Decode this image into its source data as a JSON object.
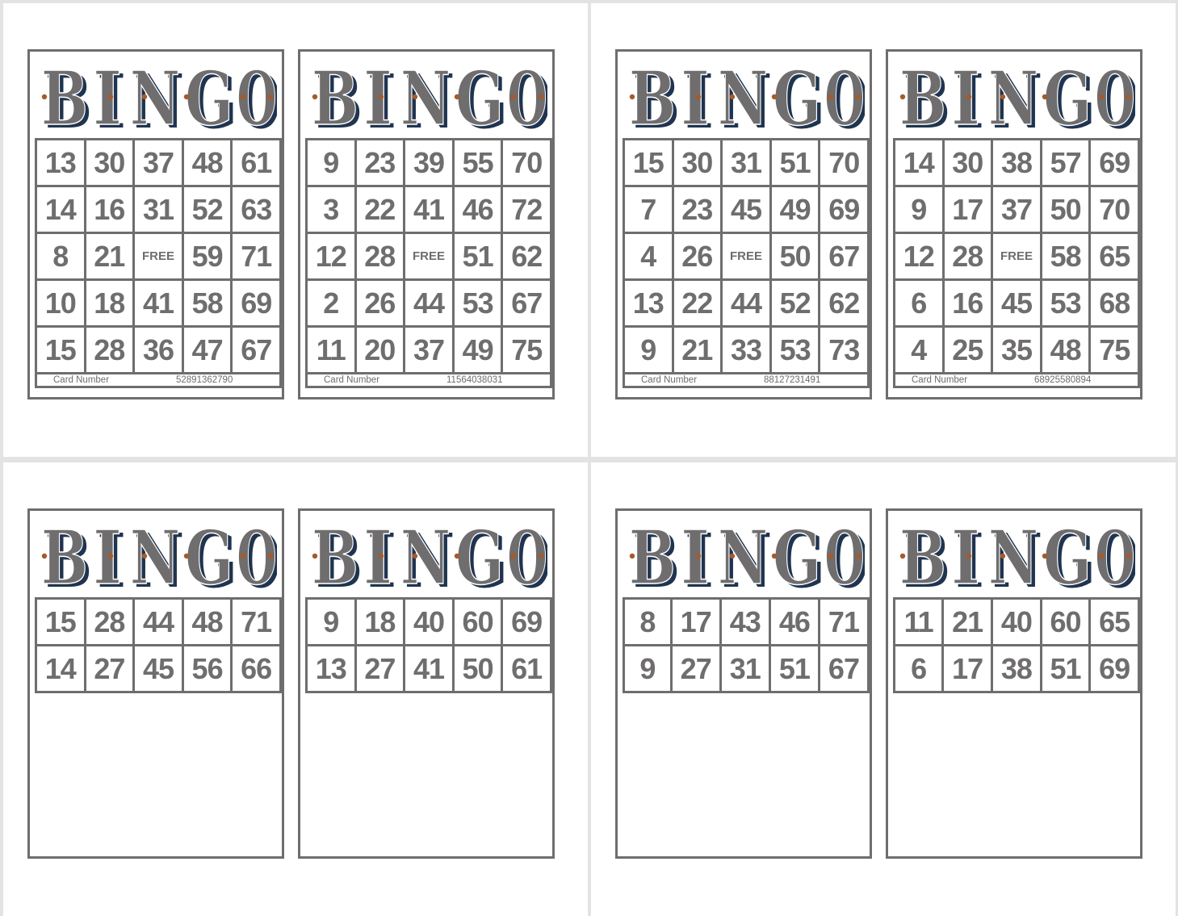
{
  "title_text": "BINGO",
  "colors": {
    "ink": "#6f6d6d",
    "shadow": "#1f3450",
    "accent": "#a65a2c",
    "page": "#ffffff",
    "background": "#e3e3e3"
  },
  "free_label": "FREE",
  "card_number_label": "Card Number",
  "pages": [
    {
      "cards": [
        {
          "card_number": "52891362790",
          "rows": [
            [
              "13",
              "30",
              "37",
              "48",
              "61"
            ],
            [
              "14",
              "16",
              "31",
              "52",
              "63"
            ],
            [
              "8",
              "21",
              "FREE",
              "59",
              "71"
            ],
            [
              "10",
              "18",
              "41",
              "58",
              "69"
            ],
            [
              "15",
              "28",
              "36",
              "47",
              "67"
            ]
          ]
        },
        {
          "card_number": "11564038031",
          "rows": [
            [
              "9",
              "23",
              "39",
              "55",
              "70"
            ],
            [
              "3",
              "22",
              "41",
              "46",
              "72"
            ],
            [
              "12",
              "28",
              "FREE",
              "51",
              "62"
            ],
            [
              "2",
              "26",
              "44",
              "53",
              "67"
            ],
            [
              "11",
              "20",
              "37",
              "49",
              "75"
            ]
          ]
        }
      ]
    },
    {
      "cards": [
        {
          "card_number": "88127231491",
          "rows": [
            [
              "15",
              "30",
              "31",
              "51",
              "70"
            ],
            [
              "7",
              "23",
              "45",
              "49",
              "69"
            ],
            [
              "4",
              "26",
              "FREE",
              "50",
              "67"
            ],
            [
              "13",
              "22",
              "44",
              "52",
              "62"
            ],
            [
              "9",
              "21",
              "33",
              "53",
              "73"
            ]
          ]
        },
        {
          "card_number": "68925580894",
          "rows": [
            [
              "14",
              "30",
              "38",
              "57",
              "69"
            ],
            [
              "9",
              "17",
              "37",
              "50",
              "70"
            ],
            [
              "12",
              "28",
              "FREE",
              "58",
              "65"
            ],
            [
              "6",
              "16",
              "45",
              "53",
              "68"
            ],
            [
              "4",
              "25",
              "35",
              "48",
              "75"
            ]
          ]
        }
      ]
    },
    {
      "cards": [
        {
          "card_number": "",
          "rows": [
            [
              "15",
              "28",
              "44",
              "48",
              "71"
            ],
            [
              "14",
              "27",
              "45",
              "56",
              "66"
            ]
          ]
        },
        {
          "card_number": "",
          "rows": [
            [
              "9",
              "18",
              "40",
              "60",
              "69"
            ],
            [
              "13",
              "27",
              "41",
              "50",
              "61"
            ]
          ]
        }
      ]
    },
    {
      "cards": [
        {
          "card_number": "",
          "rows": [
            [
              "8",
              "17",
              "43",
              "46",
              "71"
            ],
            [
              "9",
              "27",
              "31",
              "51",
              "67"
            ]
          ]
        },
        {
          "card_number": "",
          "rows": [
            [
              "11",
              "21",
              "40",
              "60",
              "65"
            ],
            [
              "6",
              "17",
              "38",
              "51",
              "69"
            ]
          ]
        }
      ]
    }
  ]
}
